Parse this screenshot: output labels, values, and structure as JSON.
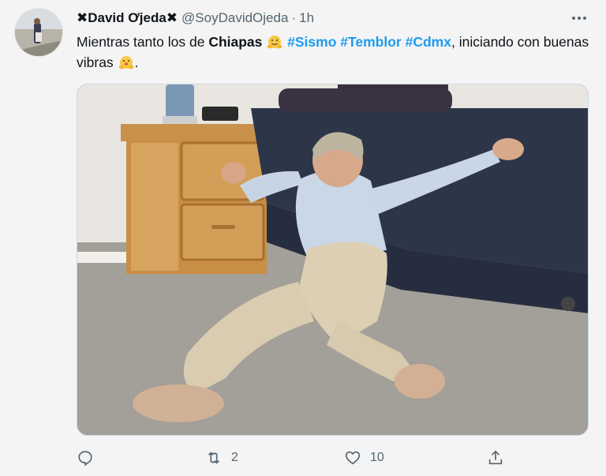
{
  "tweet": {
    "display_name": "David Ơjeda",
    "name_decoration_left": "✖",
    "name_decoration_right": "✖",
    "handle": "@SoyDavidOjeda",
    "separator": "·",
    "time": "1h",
    "text": {
      "part1": "Mientras tanto los de ",
      "bold": "Chiapas",
      "hashtags": [
        "#Sismo",
        "#Temblor",
        "#Cdmx"
      ],
      "part2": ", iniciando con buenas vibras",
      "end": "."
    },
    "emojis": [
      "hugging-face",
      "hugging-face"
    ],
    "actions": {
      "reply_count": "",
      "retweet_count": "2",
      "like_count": "10"
    }
  },
  "icons": [
    "more-icon",
    "reply-icon",
    "retweet-icon",
    "like-icon",
    "share-icon"
  ],
  "colors": {
    "link": "#1d9bf0",
    "secondary": "#536471",
    "text": "#0f1419",
    "background": "#f4f4f4"
  }
}
